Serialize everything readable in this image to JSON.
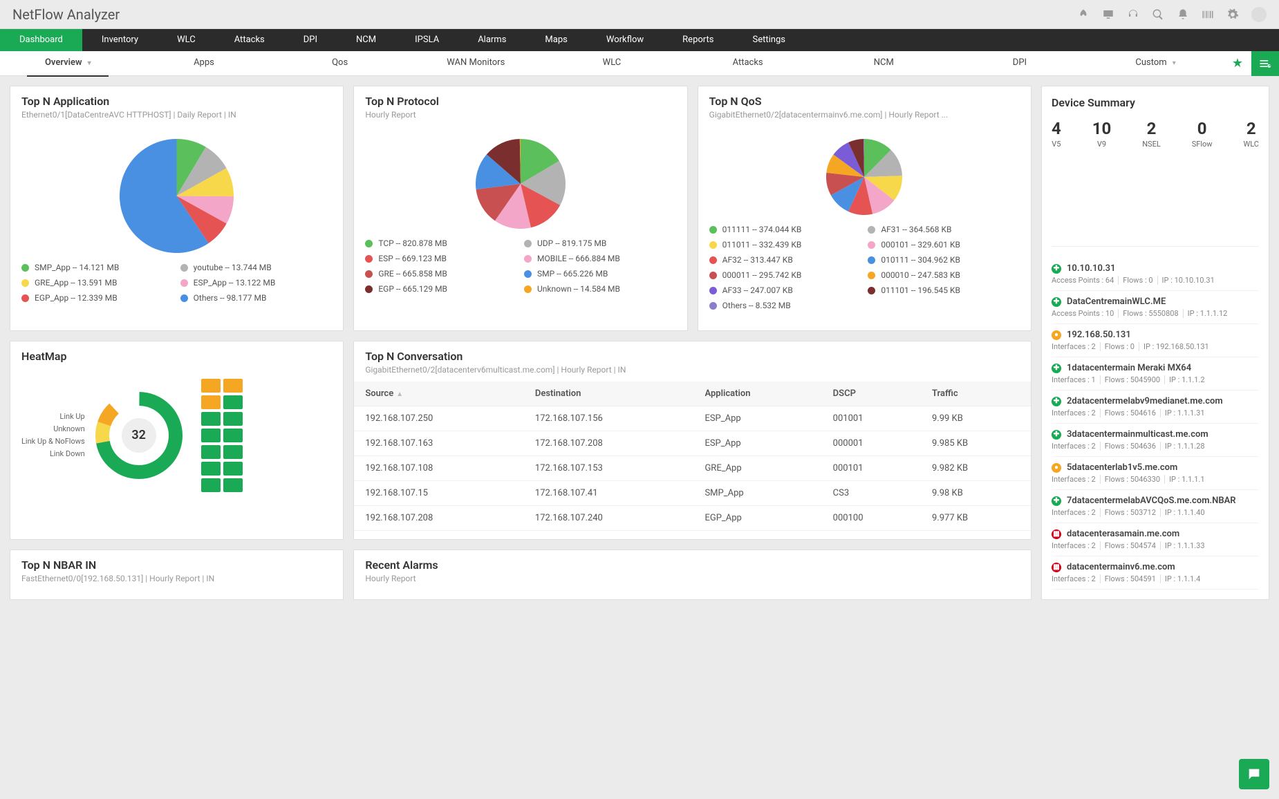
{
  "brand": "NetFlow Analyzer",
  "nav1": [
    "Dashboard",
    "Inventory",
    "WLC",
    "Attacks",
    "DPI",
    "NCM",
    "IPSLA",
    "Alarms",
    "Maps",
    "Workflow",
    "Reports",
    "Settings"
  ],
  "nav1_active": 0,
  "nav2": [
    "Overview",
    "Apps",
    "Qos",
    "WAN Monitors",
    "WLC",
    "Attacks",
    "NCM",
    "DPI",
    "Custom"
  ],
  "nav2_active": 0,
  "topApp": {
    "title": "Top N Application",
    "sub": "Ethernet0/1[DataCentreAVC HTTPHOST] | Daily Report | IN",
    "items": [
      {
        "label": "SMP_App -- 14.121 MB",
        "color": "#5bbf5b"
      },
      {
        "label": "youtube -- 13.744 MB",
        "color": "#b3b3b3"
      },
      {
        "label": "GRE_App -- 13.591 MB",
        "color": "#f7d84b"
      },
      {
        "label": "ESP_App -- 13.122 MB",
        "color": "#f4a6c8"
      },
      {
        "label": "EGP_App -- 12.339 MB",
        "color": "#e55353"
      },
      {
        "label": "Others -- 98.177 MB",
        "color": "#4a90e2"
      }
    ]
  },
  "topProto": {
    "title": "Top N Protocol",
    "sub": "Hourly Report",
    "items": [
      {
        "label": "TCP -- 820.878 MB",
        "color": "#5bbf5b"
      },
      {
        "label": "UDP -- 819.175 MB",
        "color": "#b3b3b3"
      },
      {
        "label": "ESP -- 669.123 MB",
        "color": "#e55353"
      },
      {
        "label": "MOBILE -- 666.884 MB",
        "color": "#f4a6c8"
      },
      {
        "label": "GRE -- 665.858 MB",
        "color": "#c85050"
      },
      {
        "label": "SMP -- 665.226 MB",
        "color": "#4a90e2"
      },
      {
        "label": "EGP -- 665.129 MB",
        "color": "#7a2e2e"
      },
      {
        "label": "Unknown -- 14.584 MB",
        "color": "#f5a623"
      }
    ]
  },
  "topQos": {
    "title": "Top N QoS",
    "sub": "GigabitEthernet0/2[datacentermainv6.me.com] | Hourly Report ...",
    "items": [
      {
        "label": "011111 -- 374.044 KB",
        "color": "#5bbf5b"
      },
      {
        "label": "AF31 -- 364.568 KB",
        "color": "#b3b3b3"
      },
      {
        "label": "011011 -- 332.439 KB",
        "color": "#f7d84b"
      },
      {
        "label": "000101 -- 329.601 KB",
        "color": "#f4a6c8"
      },
      {
        "label": "AF32 -- 313.447 KB",
        "color": "#e55353"
      },
      {
        "label": "010111 -- 304.962 KB",
        "color": "#4a90e2"
      },
      {
        "label": "000011 -- 295.742 KB",
        "color": "#c85050"
      },
      {
        "label": "000010 -- 247.583 KB",
        "color": "#f5a623"
      },
      {
        "label": "AF33 -- 247.007 KB",
        "color": "#7a5cd6"
      },
      {
        "label": "011101 -- 196.545 KB",
        "color": "#7a2e2e"
      },
      {
        "label": "Others -- 8.532 MB",
        "color": "#8a7fc9"
      }
    ]
  },
  "heatmap": {
    "title": "HeatMap",
    "labels": [
      "Link Up",
      "Unknown",
      "Link Up & NoFlows",
      "Link Down"
    ],
    "center": "32"
  },
  "conv": {
    "title": "Top N Conversation",
    "sub": "GigabitEthernet0/2[datacenterv6multicast.me.com] | Hourly Report | IN",
    "cols": [
      "Source",
      "Destination",
      "Application",
      "DSCP",
      "Traffic"
    ],
    "rows": [
      [
        "192.168.107.250",
        "172.168.107.156",
        "ESP_App",
        "001001",
        "9.99 KB"
      ],
      [
        "192.168.107.163",
        "172.168.107.208",
        "ESP_App",
        "000001",
        "9.985 KB"
      ],
      [
        "192.168.107.108",
        "172.168.107.153",
        "GRE_App",
        "000101",
        "9.982 KB"
      ],
      [
        "192.168.107.15",
        "172.168.107.41",
        "SMP_App",
        "CS3",
        "9.98 KB"
      ],
      [
        "192.168.107.208",
        "172.168.107.240",
        "EGP_App",
        "000100",
        "9.977 KB"
      ]
    ]
  },
  "nbar": {
    "title": "Top N NBAR IN",
    "sub": "FastEthernet0/0[192.168.50.131] | Hourly Report | IN"
  },
  "alarms": {
    "title": "Recent Alarms",
    "sub": "Hourly Report"
  },
  "summary": {
    "title": "Device Summary",
    "metrics": [
      {
        "n": "4",
        "l": "V5"
      },
      {
        "n": "10",
        "l": "V9"
      },
      {
        "n": "2",
        "l": "NSEL"
      },
      {
        "n": "0",
        "l": "SFlow"
      },
      {
        "n": "2",
        "l": "WLC"
      }
    ],
    "bars": [
      40,
      100,
      20,
      2,
      20
    ],
    "devices": [
      {
        "ico": "g",
        "name": "10.10.10.31",
        "meta": [
          "Access Points : 64",
          "Flows : 0",
          "IP : 10.10.10.31"
        ]
      },
      {
        "ico": "g",
        "name": "DataCentremainWLC.ME",
        "meta": [
          "Access Points : 10",
          "Flows : 5550808",
          "IP : 1.1.1.12"
        ]
      },
      {
        "ico": "o",
        "name": "192.168.50.131",
        "meta": [
          "Interfaces : 2",
          "Flows : 0",
          "IP : 192.168.50.131"
        ]
      },
      {
        "ico": "g",
        "name": "1datacentermain Meraki MX64",
        "meta": [
          "Interfaces : 1",
          "Flows : 5045900",
          "IP : 1.1.1.2"
        ]
      },
      {
        "ico": "g",
        "name": "2datacentermelabv9medianet.me.com",
        "meta": [
          "Interfaces : 2",
          "Flows : 504616",
          "IP : 1.1.1.31"
        ]
      },
      {
        "ico": "g",
        "name": "3datacentermainmulticast.me.com",
        "meta": [
          "Interfaces : 2",
          "Flows : 504636",
          "IP : 1.1.1.28"
        ]
      },
      {
        "ico": "o",
        "name": "5datacenterlab1v5.me.com",
        "meta": [
          "Interfaces : 2",
          "Flows : 5046330",
          "IP : 1.1.1.1"
        ]
      },
      {
        "ico": "g",
        "name": "7datacentermelabAVCQoS.me.com.NBAR",
        "meta": [
          "Interfaces : 2",
          "Flows : 503712",
          "IP : 1.1.1.40"
        ]
      },
      {
        "ico": "r",
        "name": "datacenterasamain.me.com",
        "meta": [
          "Interfaces : 2",
          "Flows : 504574",
          "IP : 1.1.1.33"
        ]
      },
      {
        "ico": "r",
        "name": "datacentermainv6.me.com",
        "meta": [
          "Interfaces : 2",
          "Flows : 504591",
          "IP : 1.1.1.4"
        ]
      }
    ]
  },
  "chart_data": [
    {
      "type": "pie",
      "title": "Top N Application",
      "series": [
        {
          "name": "SMP_App",
          "value": 14.121
        },
        {
          "name": "youtube",
          "value": 13.744
        },
        {
          "name": "GRE_App",
          "value": 13.591
        },
        {
          "name": "ESP_App",
          "value": 13.122
        },
        {
          "name": "EGP_App",
          "value": 12.339
        },
        {
          "name": "Others",
          "value": 98.177
        }
      ],
      "unit": "MB"
    },
    {
      "type": "pie",
      "title": "Top N Protocol",
      "series": [
        {
          "name": "TCP",
          "value": 820.878
        },
        {
          "name": "UDP",
          "value": 819.175
        },
        {
          "name": "ESP",
          "value": 669.123
        },
        {
          "name": "MOBILE",
          "value": 666.884
        },
        {
          "name": "GRE",
          "value": 665.858
        },
        {
          "name": "SMP",
          "value": 665.226
        },
        {
          "name": "EGP",
          "value": 665.129
        },
        {
          "name": "Unknown",
          "value": 14.584
        }
      ],
      "unit": "MB"
    },
    {
      "type": "pie",
      "title": "Top N QoS",
      "series": [
        {
          "name": "011111",
          "value": 374.044
        },
        {
          "name": "AF31",
          "value": 364.568
        },
        {
          "name": "011011",
          "value": 332.439
        },
        {
          "name": "000101",
          "value": 329.601
        },
        {
          "name": "AF32",
          "value": 313.447
        },
        {
          "name": "010111",
          "value": 304.962
        },
        {
          "name": "000011",
          "value": 295.742
        },
        {
          "name": "000010",
          "value": 247.583
        },
        {
          "name": "AF33",
          "value": 247.007
        },
        {
          "name": "011101",
          "value": 196.545
        },
        {
          "name": "Others",
          "value": 8532
        }
      ],
      "unit": "KB"
    },
    {
      "type": "bar",
      "title": "Device Summary",
      "categories": [
        "V5",
        "V9",
        "NSEL",
        "SFlow",
        "WLC"
      ],
      "values": [
        4,
        10,
        2,
        0,
        2
      ]
    },
    {
      "type": "table",
      "title": "Top N Conversation",
      "columns": [
        "Source",
        "Destination",
        "Application",
        "DSCP",
        "Traffic"
      ],
      "rows": [
        [
          "192.168.107.250",
          "172.168.107.156",
          "ESP_App",
          "001001",
          "9.99 KB"
        ],
        [
          "192.168.107.163",
          "172.168.107.208",
          "ESP_App",
          "000001",
          "9.985 KB"
        ],
        [
          "192.168.107.108",
          "172.168.107.153",
          "GRE_App",
          "000101",
          "9.982 KB"
        ],
        [
          "192.168.107.15",
          "172.168.107.41",
          "SMP_App",
          "CS3",
          "9.98 KB"
        ],
        [
          "192.168.107.208",
          "172.168.107.240",
          "EGP_App",
          "000100",
          "9.977 KB"
        ]
      ]
    },
    {
      "type": "pie",
      "title": "HeatMap",
      "categories": [
        "Link Up",
        "Unknown",
        "Link Up & NoFlows",
        "Link Down"
      ],
      "values": [
        26,
        3,
        3,
        0
      ],
      "center": 32
    }
  ]
}
